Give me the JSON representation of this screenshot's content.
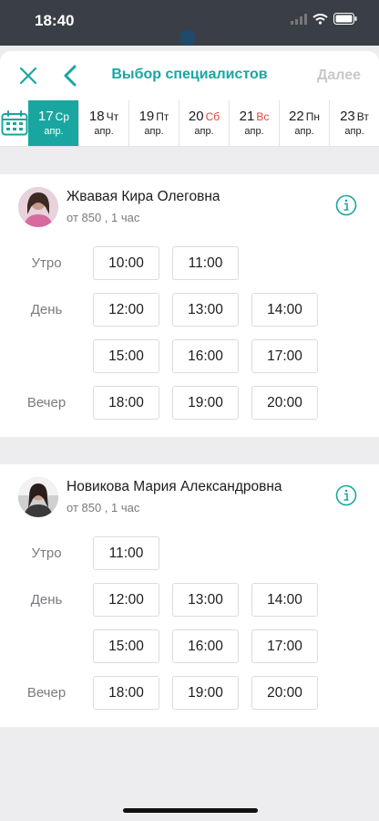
{
  "status": {
    "time": "18:40"
  },
  "nav": {
    "title": "Выбор специалистов",
    "next_label": "Далее"
  },
  "dates": [
    {
      "num": "17",
      "weekday": "Ср",
      "month": "апр.",
      "selected": true,
      "weekend": false
    },
    {
      "num": "18",
      "weekday": "Чт",
      "month": "апр.",
      "selected": false,
      "weekend": false
    },
    {
      "num": "19",
      "weekday": "Пт",
      "month": "апр.",
      "selected": false,
      "weekend": false
    },
    {
      "num": "20",
      "weekday": "Сб",
      "month": "апр.",
      "selected": false,
      "weekend": true
    },
    {
      "num": "21",
      "weekday": "Вс",
      "month": "апр.",
      "selected": false,
      "weekend": true
    },
    {
      "num": "22",
      "weekday": "Пн",
      "month": "апр.",
      "selected": false,
      "weekend": false
    },
    {
      "num": "23",
      "weekday": "Вт",
      "month": "апр.",
      "selected": false,
      "weekend": false
    }
  ],
  "specialists": [
    {
      "name": "Жвавая Кира Олеговна",
      "meta": "от 850 , 1 час",
      "rows": [
        {
          "period": "Утро",
          "times": [
            "10:00",
            "11:00"
          ]
        },
        {
          "period": "День",
          "times": [
            "12:00",
            "13:00",
            "14:00"
          ]
        },
        {
          "period": "",
          "times": [
            "15:00",
            "16:00",
            "17:00"
          ]
        },
        {
          "period": "Вечер",
          "times": [
            "18:00",
            "19:00",
            "20:00"
          ]
        }
      ]
    },
    {
      "name": "Новикова Мария Александровна",
      "meta": "от 850 , 1 час",
      "rows": [
        {
          "period": "Утро",
          "times": [
            "11:00"
          ]
        },
        {
          "period": "День",
          "times": [
            "12:00",
            "13:00",
            "14:00"
          ]
        },
        {
          "period": "",
          "times": [
            "15:00",
            "16:00",
            "17:00"
          ]
        },
        {
          "period": "Вечер",
          "times": [
            "18:00",
            "19:00",
            "20:00"
          ]
        }
      ]
    }
  ],
  "colors": {
    "accent": "#1aa6a0",
    "weekend": "#e0473c",
    "muted": "#7a7a80",
    "disabled": "#c8c8cc"
  },
  "icons": {
    "close": "close-icon",
    "back": "chevron-left-icon",
    "calendar": "calendar-icon",
    "info": "info-icon",
    "wifi": "wifi-icon",
    "battery": "battery-icon",
    "signal": "signal-icon"
  }
}
